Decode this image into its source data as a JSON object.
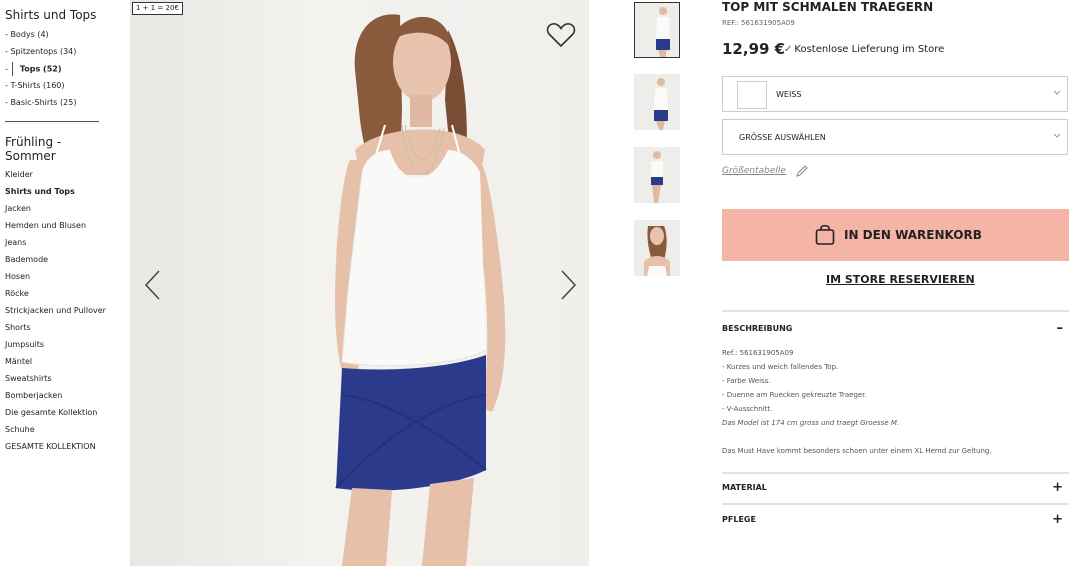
{
  "nav": {
    "section_title": "Shirts und Tops",
    "sub_items": [
      {
        "label": "Bodys (4)",
        "prefix": "- "
      },
      {
        "label": "Spitzentops (34)",
        "prefix": "- "
      },
      {
        "label": "Tops (52)",
        "prefix": "-",
        "active": true
      },
      {
        "label": "T-Shirts (160)",
        "prefix": "- "
      },
      {
        "label": "Basic-Shirts (25)",
        "prefix": "- "
      }
    ],
    "season_title": "Frühling - Sommer",
    "categories": [
      "Kleider",
      "Shirts und Tops",
      "Jacken",
      "Hemden und Blusen",
      "Jeans",
      "Bademode",
      "Hosen",
      "Röcke",
      "Strickjacken und Pullover",
      "Shorts",
      "Jumpsuits",
      "Mäntel",
      "Sweatshirts",
      "Bomberjacken",
      "Die gesamte Kollektion",
      "Schuhe",
      "GESAMTE KOLLEKTION"
    ]
  },
  "gallery": {
    "promo_badge": "1 + 1 = 20€",
    "favorite_icon": "heart-outline-icon",
    "prev_icon": "chevron-left-icon",
    "next_icon": "chevron-right-icon"
  },
  "product": {
    "title": "TOP MIT SCHMALEN TRAEGERN",
    "ref": "REF.: 561631905A09",
    "price": "12,99 €",
    "delivery": "Kostenlose Lieferung im Store",
    "color_value": "WEISS",
    "size_placeholder": "GRÖSSE AUSWÄHLEN",
    "size_guide": "Größentabelle",
    "cart_button": "IN DEN WARENKORB",
    "reserve_link": "IM STORE RESERVIEREN"
  },
  "description": {
    "heading": "BESCHREIBUNG",
    "toggle": "–",
    "ref": "Ref.: 561631905A09",
    "lines": [
      "- Kurzes und weich fallendes Top.",
      "- Farbe Weiss.",
      "- Duenne am Ruecken gekreuzte Traeger.",
      "- V-Ausschnitt."
    ],
    "model_note": "Das Model ist 174 cm gross und traegt Groesse M.",
    "outro": "Das Must Have kommt besonders schoen unter einem XL Hemd zur Geltung."
  },
  "accordions": [
    {
      "label": "MATERIAL",
      "toggle": "+"
    },
    {
      "label": "PFLEGE",
      "toggle": "+"
    }
  ],
  "colors": {
    "cart_button": "#f4b5a6",
    "skirt": "#2c3a8c",
    "top": "#f7f7f5"
  }
}
